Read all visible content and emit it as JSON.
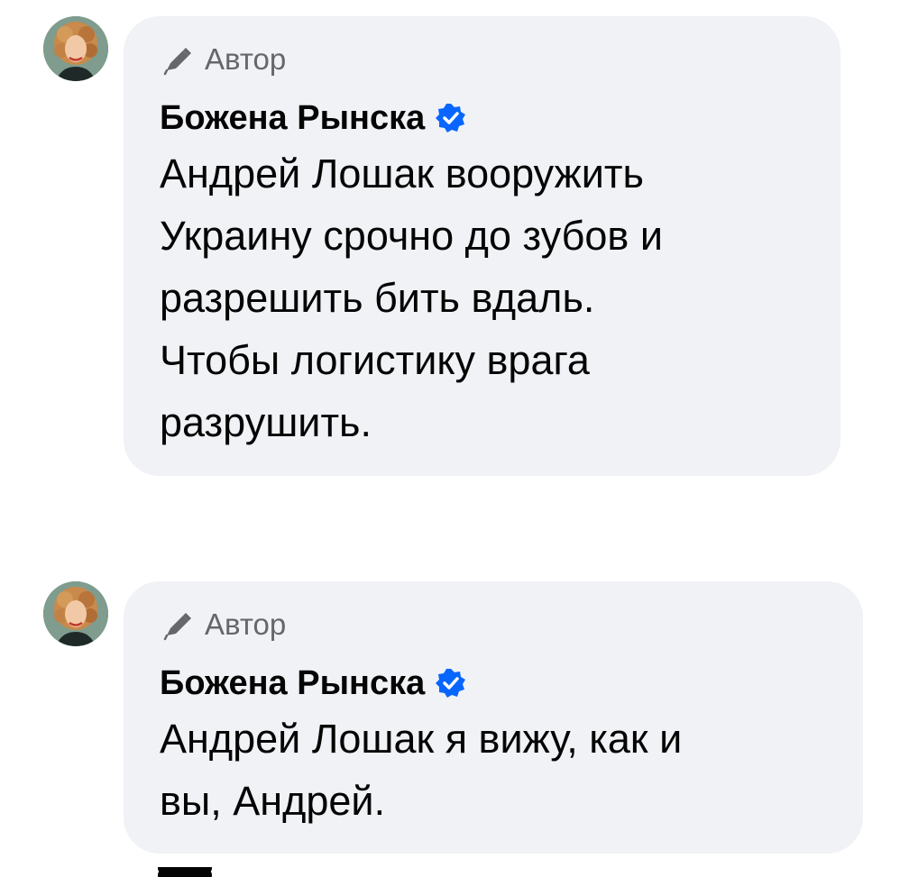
{
  "comments": [
    {
      "author_badge": "Автор",
      "name": "Божена Рынска",
      "verified": true,
      "text_lines": [
        "Андрей Лошак вооружить",
        "Украину срочно до зубов и",
        "разрешить бить вдаль.",
        "Чтобы логистику врага",
        "разрушить."
      ]
    },
    {
      "author_badge": "Автор",
      "name": "Божена Рынска",
      "verified": true,
      "text_lines": [
        "Андрей Лошак я вижу, как и",
        "вы, Андрей."
      ]
    }
  ],
  "colors": {
    "bubble_bg": "#f0f2f5",
    "verified_blue": "#0866ff",
    "secondary_text": "#65676b",
    "primary_text": "#050505"
  },
  "icons": {
    "badge": "pen-icon",
    "verified": "verified-check-icon"
  }
}
